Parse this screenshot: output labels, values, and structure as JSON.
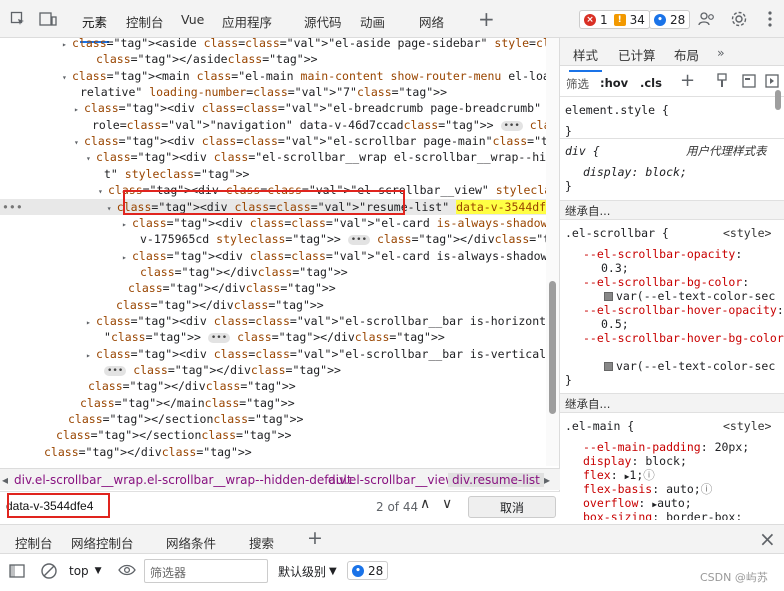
{
  "toolbar": {
    "tabs": [
      "元素",
      "控制台",
      "Vue",
      "应用程序",
      "源代码",
      "动画",
      "网络"
    ],
    "add_tab": "+",
    "errors": "1",
    "warnings": "34",
    "messages": "28",
    "icons": [
      "inspect-icon",
      "device-icon",
      "plus-icon",
      "people-icon",
      "gear-icon",
      "more-icon"
    ]
  },
  "elements_lines": [
    {
      "indent": 72,
      "html": "&lt;aside class=\"el-aside page-sidebar\" style=\"--el-aside-width: 250px;\"&gt;",
      "raw": "<aside class=\"el-aside page-sidebar\" style=\"--el-aside-width: 250px;\">"
    },
    {
      "indent": 96,
      "raw": "</aside>"
    },
    {
      "indent": 72,
      "raw": "<main class=\"el-main main-content show-router-menu el-loading-parent--"
    },
    {
      "indent": 80,
      "raw": "relative\" loading-number=\"7\">"
    },
    {
      "indent": 84,
      "raw": "<div class=\"el-breadcrumb page-breadcrumb\" aria-label=\"Breadcrumb\""
    },
    {
      "indent": 92,
      "raw": "role=\"navigation\" data-v-46d7ccad> ••• </div>"
    },
    {
      "indent": 84,
      "raw": "<div class=\"el-scrollbar page-main\">"
    },
    {
      "indent": 96,
      "raw": "<div class=\"el-scrollbar__wrap el-scrollbar__wrap--hidden-defaul"
    },
    {
      "indent": 104,
      "raw": "t\" style>"
    },
    {
      "indent": 108,
      "raw": "<div class=\"el-scrollbar__view\" style>"
    },
    {
      "indent": 120,
      "raw": "<div class=\"resume-list\" data-v-3544dfe4> == $0"
    },
    {
      "indent": 132,
      "raw": "<div class=\"el-card is-always-shadow mb-20 search-form\" data-"
    },
    {
      "indent": 140,
      "raw": "v-175965cd style> ••• </div>"
    },
    {
      "indent": 132,
      "raw": "<div class=\"el-card is-always-shadow\" data-v-175965cd>"
    },
    {
      "indent": 140,
      "raw": "</div>"
    },
    {
      "indent": 128,
      "raw": "</div>"
    },
    {
      "indent": 116,
      "raw": "</div>"
    },
    {
      "indent": 96,
      "raw": "<div class=\"el-scrollbar__bar is-horizontal\" style=\"display: none;"
    },
    {
      "indent": 104,
      "raw": "\"> ••• </div>"
    },
    {
      "indent": 96,
      "raw": "<div class=\"el-scrollbar__bar is-vertical\" style=\"display: none;\">"
    },
    {
      "indent": 104,
      "raw": "••• </div>"
    },
    {
      "indent": 88,
      "raw": "</div>"
    },
    {
      "indent": 80,
      "raw": "</main>"
    },
    {
      "indent": 68,
      "raw": "</section>"
    },
    {
      "indent": 56,
      "raw": "</section>"
    },
    {
      "indent": 44,
      "raw": "</div>"
    }
  ],
  "selected_node": {
    "tag_open": "<div class=\"resume-list\" ",
    "attr_hl": "data-v-3544dfe4",
    "tag_close": ">",
    "marker": " == $0"
  },
  "breadcrumbs": [
    "div.el-scrollbar__wrap.el-scrollbar__wrap--hidden-default",
    "div.el-scrollbar__view",
    "div.resume-list"
  ],
  "search": {
    "value": "data-v-3544dfe4",
    "count": "2 of 44",
    "cancel": "取消"
  },
  "styles": {
    "tabs": [
      "样式",
      "已计算",
      "布局"
    ],
    "filter_placeholder": "筛选",
    "hov": ":hov",
    "cls": ".cls",
    "element_style_head": "element.style {",
    "close_brace": "}",
    "ua_selector": "div {",
    "ua_label": "用户代理样式表",
    "ua_prop": "display",
    "ua_val": "block;",
    "inherited_1": "继承自...",
    "scrollbar_selector": ".el-scrollbar {",
    "scrollbar_source": "<style>",
    "scrollbar_props": [
      {
        "p": "--el-scrollbar-opacity",
        "v": "0.3;"
      },
      {
        "p": "--el-scrollbar-bg-color",
        "v": "var(--el-text-color-sec"
      },
      {
        "p": "--el-scrollbar-hover-opacity",
        "v": "0.5;"
      },
      {
        "p": "--el-scrollbar-hover-bg-color",
        "v": "var(--el-text-color-sec"
      }
    ],
    "inherited_2": "继承自...",
    "main_selector": ".el-main {",
    "main_source": "<style>",
    "main_props": [
      {
        "p": "--el-main-padding",
        "v": "20px;"
      },
      {
        "p": "display",
        "v": "block;"
      },
      {
        "p": "flex",
        "v": "1;"
      },
      {
        "p": "flex-basis",
        "v": "auto;"
      },
      {
        "p": "overflow",
        "v": "auto;"
      },
      {
        "p": "box-sizing",
        "v": "border-box;"
      }
    ]
  },
  "drawer": {
    "tabs": [
      "控制台",
      "网络控制台",
      "网络条件",
      "搜索"
    ],
    "add": "+",
    "close": "×",
    "context": "top",
    "filter_placeholder": "筛选器",
    "level": "默认级别",
    "level_arrow": "▼",
    "messages": "28"
  },
  "watermark": "CSDN @屿苏"
}
